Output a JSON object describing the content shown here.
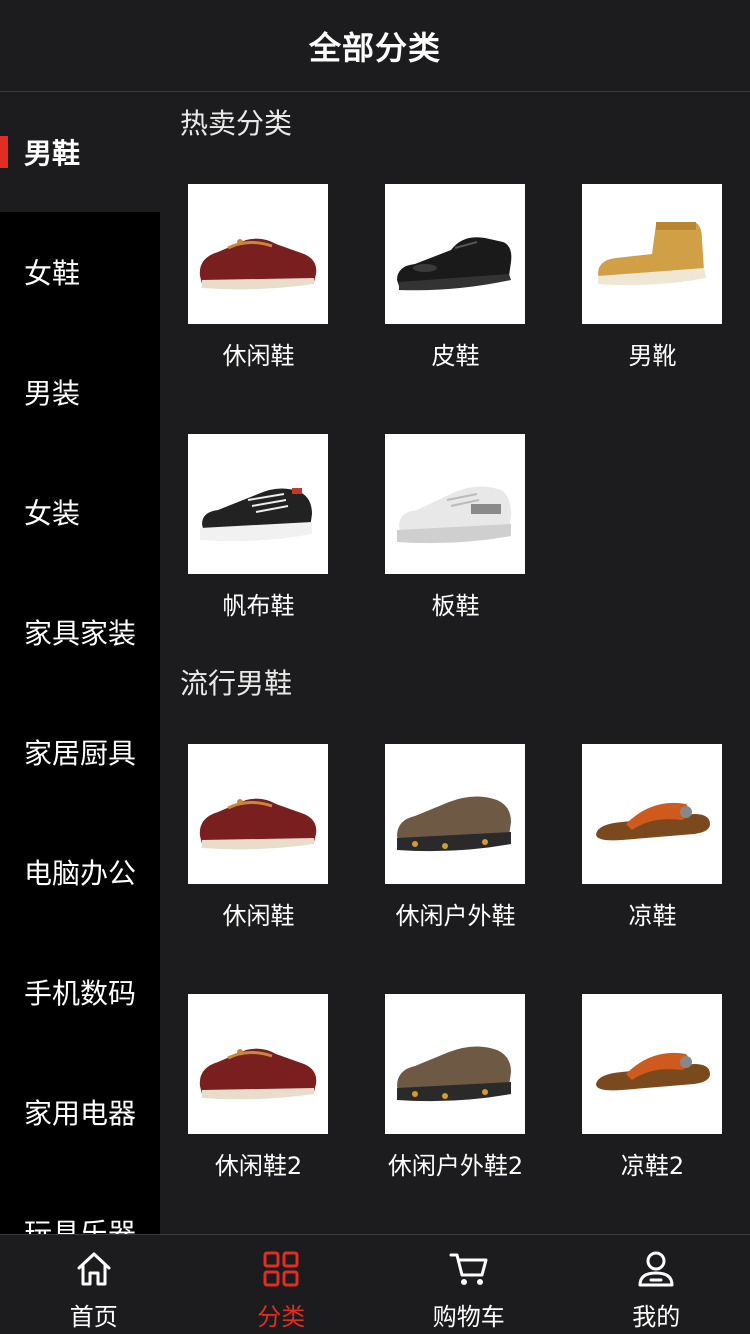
{
  "header": {
    "title": "全部分类"
  },
  "sidebar": {
    "items": [
      {
        "label": "男鞋"
      },
      {
        "label": "女鞋"
      },
      {
        "label": "男装"
      },
      {
        "label": "女装"
      },
      {
        "label": "家具家装"
      },
      {
        "label": "家居厨具"
      },
      {
        "label": "电脑办公"
      },
      {
        "label": "手机数码"
      },
      {
        "label": "家用电器"
      },
      {
        "label": "玩具乐器"
      }
    ]
  },
  "sections": [
    {
      "title": "热卖分类",
      "products": [
        {
          "name": "休闲鞋",
          "image": "red-loafer"
        },
        {
          "name": "皮鞋",
          "image": "black-oxford"
        },
        {
          "name": "男靴",
          "image": "tan-boot"
        },
        {
          "name": "帆布鞋",
          "image": "black-canvas-sneaker"
        },
        {
          "name": "板鞋",
          "image": "white-skate-shoe"
        }
      ]
    },
    {
      "title": "流行男鞋",
      "products": [
        {
          "name": "休闲鞋",
          "image": "red-loafer"
        },
        {
          "name": "休闲户外鞋",
          "image": "brown-outdoor-shoe"
        },
        {
          "name": "凉鞋",
          "image": "orange-sandal"
        },
        {
          "name": "休闲鞋2",
          "image": "red-loafer"
        },
        {
          "name": "休闲户外鞋2",
          "image": "brown-outdoor-shoe"
        },
        {
          "name": "凉鞋2",
          "image": "orange-sandal"
        }
      ]
    }
  ],
  "tabbar": {
    "tabs": [
      {
        "label": "首页",
        "icon": "home-icon"
      },
      {
        "label": "分类",
        "icon": "category-icon"
      },
      {
        "label": "购物车",
        "icon": "cart-icon"
      },
      {
        "label": "我的",
        "icon": "user-icon"
      }
    ]
  },
  "colors": {
    "accent": "#e02e24",
    "background": "#1c1b1d",
    "sidebar": "#000000"
  }
}
